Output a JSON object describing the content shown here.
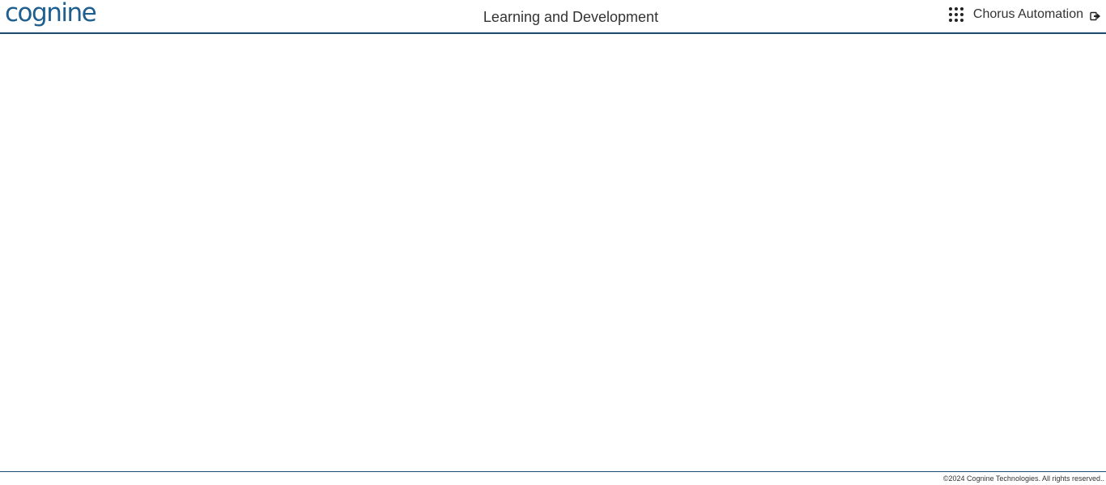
{
  "header": {
    "logo_text": "cognine",
    "page_title": "Learning and Development",
    "user_name": "Chorus Automation",
    "apps_icon": "grid-dots-icon",
    "logout_icon": "logout-icon"
  },
  "footer": {
    "copyright": "©2024 Cognine Technologies. All rights reserved.."
  },
  "colors": {
    "brand": "#1f5f8f",
    "header_border": "#1b4a6e"
  }
}
